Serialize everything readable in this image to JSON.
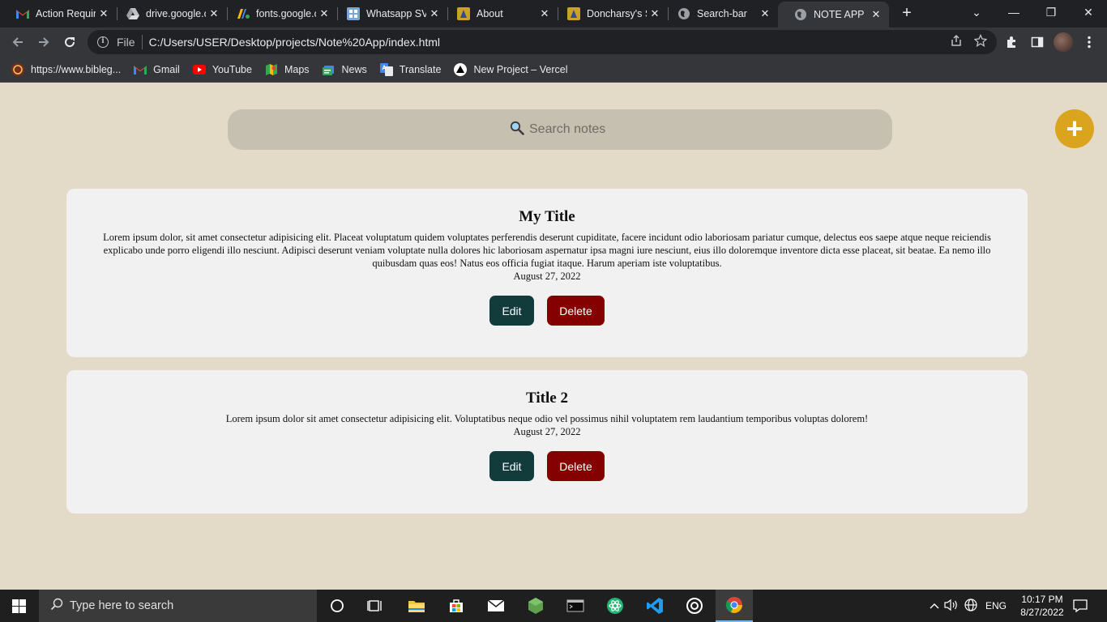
{
  "browser": {
    "tabs": [
      {
        "title": "Action Required",
        "favicon": "gmail-icon"
      },
      {
        "title": "drive.google.com",
        "favicon": "drive-icon"
      },
      {
        "title": "fonts.google.com",
        "favicon": "fonts-icon"
      },
      {
        "title": "Whatsapp SVG",
        "favicon": "repo-icon"
      },
      {
        "title": "About",
        "favicon": "site-icon"
      },
      {
        "title": "Doncharsy's Site",
        "favicon": "site-icon"
      },
      {
        "title": "Search-bar",
        "favicon": "globe-icon"
      },
      {
        "title": "NOTE APP",
        "favicon": "globe-icon",
        "active": true
      }
    ],
    "new_tab": "+",
    "controls": {
      "tab_search": "⌄",
      "minimize": "—",
      "restore": "❐",
      "close": "✕"
    },
    "address": {
      "scheme_label": "File",
      "url": "C:/Users/USER/Desktop/projects/Note%20App/index.html"
    },
    "bookmarks": [
      {
        "label": "https://www.bibleg...",
        "icon": "biblegateway-icon"
      },
      {
        "label": "Gmail",
        "icon": "gmail-icon"
      },
      {
        "label": "YouTube",
        "icon": "youtube-icon"
      },
      {
        "label": "Maps",
        "icon": "maps-icon"
      },
      {
        "label": "News",
        "icon": "news-icon"
      },
      {
        "label": "Translate",
        "icon": "translate-icon"
      },
      {
        "label": "New Project – Vercel",
        "icon": "vercel-icon"
      }
    ]
  },
  "app": {
    "search": {
      "placeholder": "Search notes",
      "value": ""
    },
    "add_button": "+",
    "accent_color": "#dba41f",
    "notes": [
      {
        "title": "My Title",
        "body": "Lorem ipsum dolor, sit amet consectetur adipisicing elit. Placeat voluptatum quidem voluptates perferendis deserunt cupiditate, facere incidunt odio laboriosam pariatur cumque, delectus eos saepe atque neque reiciendis explicabo unde porro eligendi illo nesciunt. Adipisci deserunt veniam voluptate nulla dolores hic laboriosam aspernatur ipsa magni iure nesciunt, eius illo doloremque inventore dicta esse placeat, sit beatae. Ea nemo illo quibusdam quas eos! Natus eos officia fugiat itaque. Harum aperiam iste voluptatibus.",
        "date": "August 27, 2022",
        "edit_label": "Edit",
        "delete_label": "Delete"
      },
      {
        "title": "Title 2",
        "body": "Lorem ipsum dolor sit amet consectetur adipisicing elit. Voluptatibus neque odio vel possimus nihil voluptatem rem laudantium temporibus voluptas dolorem!",
        "date": "August 27, 2022",
        "edit_label": "Edit",
        "delete_label": "Delete"
      }
    ]
  },
  "taskbar": {
    "search_placeholder": "Type here to search",
    "language": "ENG",
    "time": "10:17 PM",
    "date": "8/27/2022"
  }
}
